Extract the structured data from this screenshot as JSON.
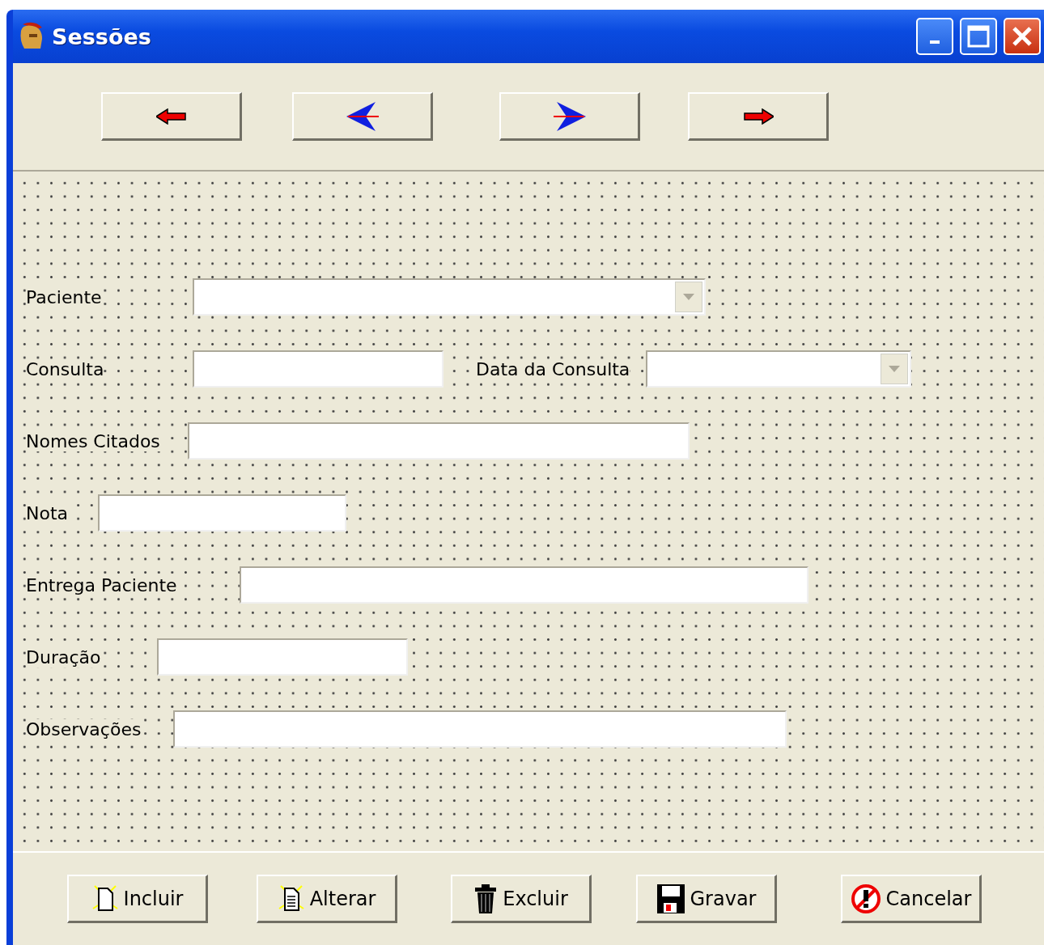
{
  "window": {
    "title": "Sessões"
  },
  "nav_buttons": [
    {
      "kind": "first"
    },
    {
      "kind": "prev"
    },
    {
      "kind": "next"
    },
    {
      "kind": "last"
    }
  ],
  "form_rows": [
    {
      "label": "Paciente",
      "kind": "combo"
    },
    {
      "label": "Consulta",
      "kind": "text",
      "extra": {
        "label": "Data da Consulta",
        "kind": "combo"
      }
    },
    {
      "label": "Nomes Citados",
      "kind": "text"
    },
    {
      "label": "Nota",
      "kind": "text"
    },
    {
      "label": "Entrega Paciente",
      "kind": "text"
    },
    {
      "label": "Duração",
      "kind": "text"
    },
    {
      "label": "Observações",
      "kind": "text"
    }
  ],
  "action_buttons": [
    {
      "label": "Incluir",
      "kind": "new"
    },
    {
      "label": "Alterar",
      "kind": "edit"
    },
    {
      "label": "Excluir",
      "kind": "delete"
    },
    {
      "label": "Gravar",
      "kind": "save"
    },
    {
      "label": "Cancelar",
      "kind": "cancel"
    }
  ]
}
